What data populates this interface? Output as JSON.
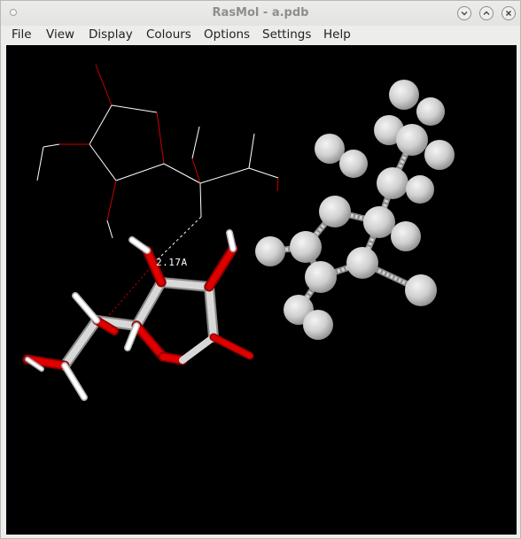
{
  "window": {
    "title": "RasMol - a.pdb",
    "controls": [
      "minimize",
      "maximize",
      "close"
    ]
  },
  "menu": {
    "items": [
      "File",
      "View",
      "Display",
      "Colours",
      "Options",
      "Settings",
      "Help"
    ]
  },
  "viewer": {
    "background": "#000000",
    "distance_label": "2.17A",
    "colors": {
      "carbon": "#c8c8c8",
      "oxygen": "#e00000",
      "hydrogen": "#ffffff",
      "ball": "#cfcfcf"
    }
  }
}
